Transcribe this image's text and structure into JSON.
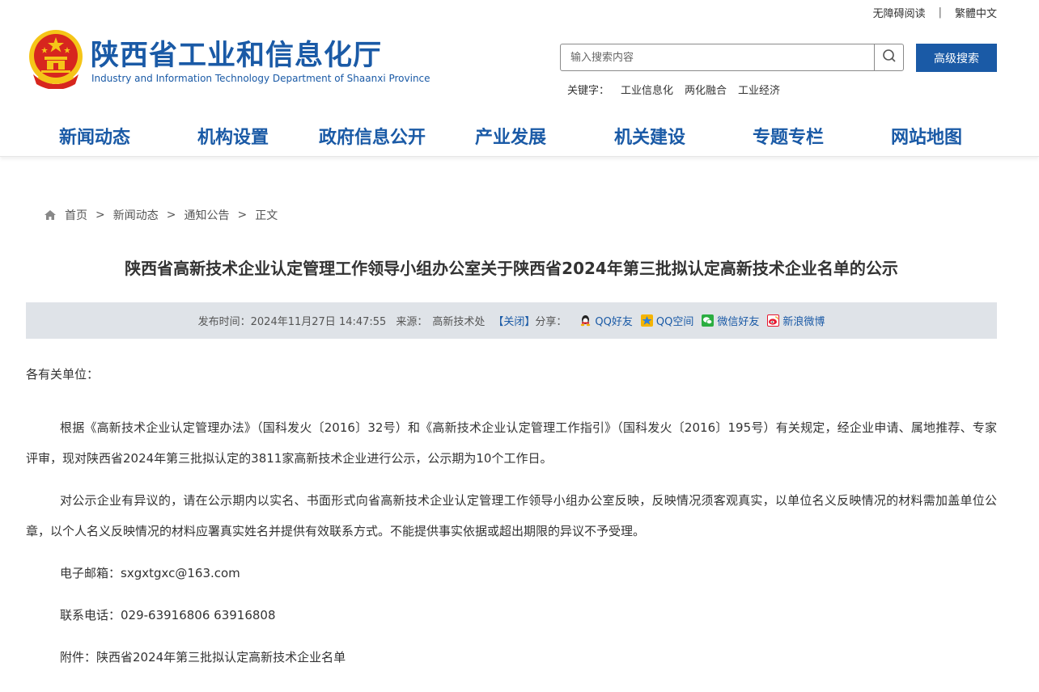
{
  "topbar": {
    "accessibility": "无障碍阅读",
    "separator": "|",
    "traditional": "繁體中文"
  },
  "header": {
    "title_cn": "陕西省工业和信息化厅",
    "title_en": "Industry and Information Technology Department of Shaanxi Province",
    "emblem_icon": "national-emblem-icon"
  },
  "search": {
    "placeholder": "输入搜索内容",
    "advanced_label": "高级搜索",
    "keywords_label": "关键字：",
    "keywords": [
      "工业信息化",
      "两化融合",
      "工业经济"
    ]
  },
  "nav": {
    "items": [
      "新闻动态",
      "机构设置",
      "政府信息公开",
      "产业发展",
      "机关建设",
      "专题专栏",
      "网站地图"
    ]
  },
  "breadcrumb": {
    "items": [
      "首页",
      "新闻动态",
      "通知公告",
      "正文"
    ],
    "separator": ">"
  },
  "article": {
    "title": "陕西省高新技术企业认定管理工作领导小组办公室关于陕西省2024年第三批拟认定高新技术企业名单的公示",
    "meta": {
      "publish_label": "发布时间：",
      "publish_time": "2024年11月27日 14:47:55",
      "source_label": "来源：",
      "source": "高新技术处",
      "close": "【关闭】",
      "share_label": "分享：",
      "share": [
        "QQ好友",
        "QQ空间",
        "微信好友",
        "新浪微博"
      ]
    },
    "salutation": "各有关单位：",
    "paragraphs": [
      "根据《高新技术企业认定管理办法》（国科发火〔2016〕32号）和《高新技术企业认定管理工作指引》（国科发火〔2016〕195号）有关规定，经企业申请、属地推荐、专家评审，现对陕西省2024年第三批拟认定的3811家高新技术企业进行公示，公示期为10个工作日。",
      "对公示企业有异议的，请在公示期内以实名、书面形式向省高新技术企业认定管理工作领导小组办公室反映，反映情况须客观真实，以单位名义反映情况的材料需加盖单位公章，以个人名义反映情况的材料应署真实姓名并提供有效联系方式。不能提供事实依据或超出期限的异议不予受理。"
    ],
    "email_line": "电子邮箱：sxgxtgxc@163.com",
    "phone_line": "联系电话：029-63916806  63916808",
    "attachment_line": "附件：陕西省2024年第三批拟认定高新技术企业名单"
  },
  "colors": {
    "brand_blue": "#1a5aa6",
    "meta_bg": "#dfe3e8",
    "emblem_red": "#d7261e",
    "emblem_gold": "#f5c518"
  }
}
